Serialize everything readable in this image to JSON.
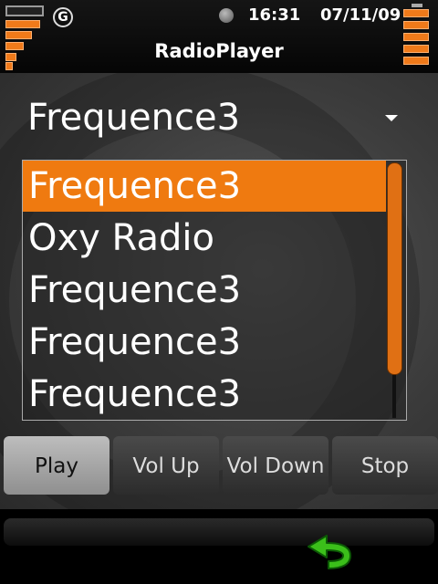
{
  "status": {
    "network_label": "G",
    "time": "16:31",
    "date": "07/11/09"
  },
  "app": {
    "title": "RadioPlayer"
  },
  "dropdown": {
    "selected": "Frequence3"
  },
  "stations": [
    {
      "label": "Frequence3",
      "selected": true
    },
    {
      "label": "Oxy Radio",
      "selected": false
    },
    {
      "label": "Frequence3",
      "selected": false
    },
    {
      "label": "Frequence3",
      "selected": false
    },
    {
      "label": "Frequence3",
      "selected": false
    }
  ],
  "buttons": {
    "play": "Play",
    "vol_up": "Vol Up",
    "vol_down": "Vol Down",
    "stop": "Stop"
  },
  "colors": {
    "accent": "#ef7a10"
  },
  "icons": {
    "signal": "signal-strength-icon",
    "network": "g-network-icon",
    "status_dot": "status-dot-icon",
    "battery": "battery-icon",
    "back": "back-arrow-icon"
  }
}
